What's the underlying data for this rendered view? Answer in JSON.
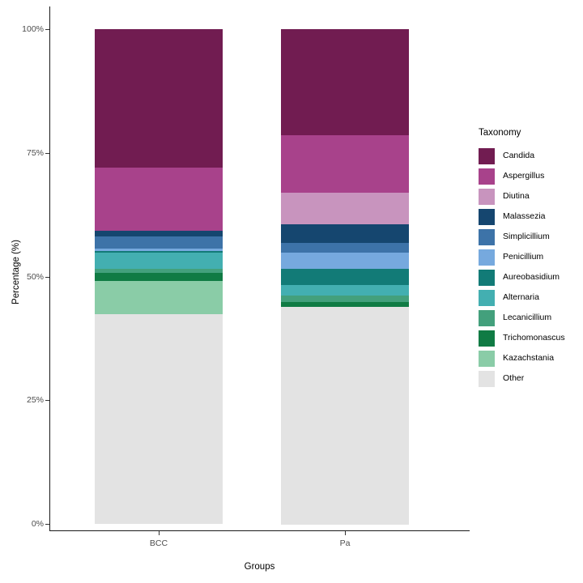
{
  "chart_data": {
    "type": "bar",
    "subtype": "stacked-percentage",
    "title": "",
    "xlabel": "Groups",
    "ylabel": "Percentage (%)",
    "categories": [
      "BCC",
      "Pa"
    ],
    "ytick_labels": [
      "0%",
      "25%",
      "50%",
      "75%",
      "100%"
    ],
    "ytick_values": [
      0,
      25,
      50,
      75,
      100
    ],
    "ylim": [
      0,
      100
    ],
    "grid": false,
    "legend_position": "right",
    "legend_title": "Taxonomy",
    "series": [
      {
        "name": "Candida",
        "color": "#711C51",
        "values": [
          28.0,
          21.4
        ]
      },
      {
        "name": "Aspergillus",
        "color": "#A8428B",
        "values": [
          12.8,
          11.6
        ]
      },
      {
        "name": "Diutina",
        "color": "#C894BE",
        "values": [
          0.0,
          6.4
        ]
      },
      {
        "name": "Malassezia",
        "color": "#15466F",
        "values": [
          1.1,
          3.8
        ]
      },
      {
        "name": "Simplicillium",
        "color": "#3D73A8",
        "values": [
          2.5,
          2.0
        ]
      },
      {
        "name": "Penicillium",
        "color": "#76A9DE",
        "values": [
          0.5,
          3.3
        ]
      },
      {
        "name": "Aureobasidium",
        "color": "#127B77",
        "values": [
          0.3,
          3.3
        ]
      },
      {
        "name": "Alternaria",
        "color": "#43AFB1",
        "values": [
          3.3,
          2.0
        ]
      },
      {
        "name": "Lecanicillium",
        "color": "#43A07C",
        "values": [
          0.8,
          1.3
        ]
      },
      {
        "name": "Trichomonascus",
        "color": "#107B44",
        "values": [
          1.6,
          1.0
        ]
      },
      {
        "name": "Kazachstania",
        "color": "#8ACCA7",
        "values": [
          6.7,
          0.0
        ]
      },
      {
        "name": "Other",
        "color": "#E3E3E3",
        "values": [
          42.4,
          44.0
        ]
      }
    ]
  },
  "axes": {
    "y_title": "Percentage (%)",
    "x_title": "Groups",
    "y_ticks": [
      {
        "label": "100%",
        "value": 100
      },
      {
        "label": "75%",
        "value": 75
      },
      {
        "label": "50%",
        "value": 50
      },
      {
        "label": "25%",
        "value": 25
      },
      {
        "label": "0%",
        "value": 0
      }
    ],
    "x_ticks": [
      {
        "label": "BCC"
      },
      {
        "label": "Pa"
      }
    ]
  },
  "legend": {
    "title": "Taxonomy",
    "items": [
      {
        "label": "Candida",
        "color": "#711C51"
      },
      {
        "label": "Aspergillus",
        "color": "#A8428B"
      },
      {
        "label": "Diutina",
        "color": "#C894BE"
      },
      {
        "label": "Malassezia",
        "color": "#15466F"
      },
      {
        "label": "Simplicillium",
        "color": "#3D73A8"
      },
      {
        "label": "Penicillium",
        "color": "#76A9DE"
      },
      {
        "label": "Aureobasidium",
        "color": "#127B77"
      },
      {
        "label": "Alternaria",
        "color": "#43AFB1"
      },
      {
        "label": "Lecanicillium",
        "color": "#43A07C"
      },
      {
        "label": "Trichomonascus",
        "color": "#107B44"
      },
      {
        "label": "Kazachstania",
        "color": "#8ACCA7"
      },
      {
        "label": "Other",
        "color": "#E3E3E3"
      }
    ]
  }
}
